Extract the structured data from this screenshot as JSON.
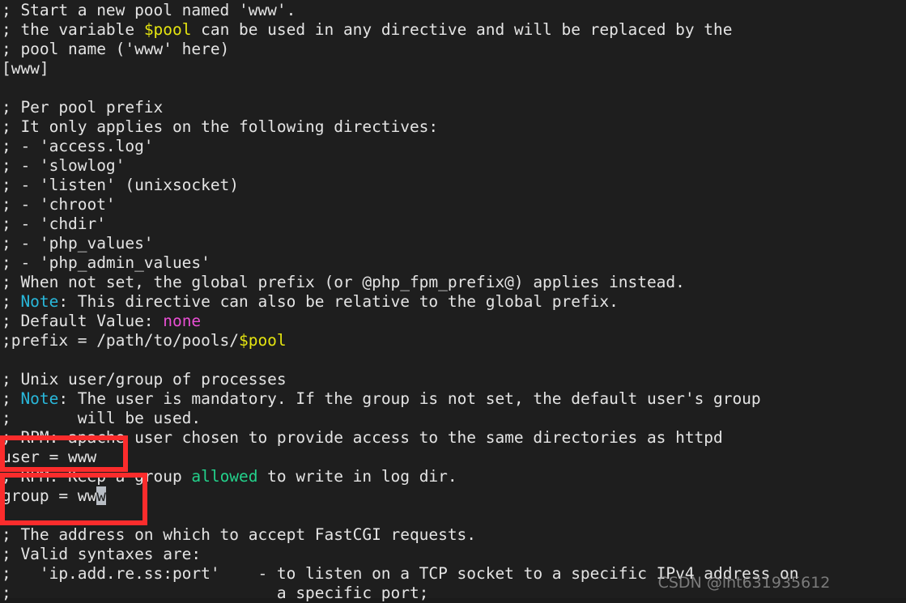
{
  "terminal": {
    "background_color": "#1e1e1e",
    "foreground_color": "#e4e4e4",
    "colors": {
      "variable_yellow": "#e5e510",
      "note_cyan": "#29b8db",
      "none_magenta": "#e94fd4",
      "allowed_green": "#23d18b",
      "cursor_gray": "#b8bdc4",
      "annotation_red": "#fb2c2c"
    },
    "file_content_lines": [
      "; Start a new pool named 'www'.",
      "; the variable $pool can be used in any directive and will be replaced by the",
      "; pool name ('www' here)",
      "[www]",
      "",
      "; Per pool prefix",
      "; It only applies on the following directives:",
      "; - 'access.log'",
      "; - 'slowlog'",
      "; - 'listen' (unixsocket)",
      "; - 'chroot'",
      "; - 'chdir'",
      "; - 'php_values'",
      "; - 'php_admin_values'",
      "; When not set, the global prefix (or @php_fpm_prefix@) applies instead.",
      "; Note: This directive can also be relative to the global prefix.",
      "; Default Value: none",
      ";prefix = /path/to/pools/$pool",
      "",
      "; Unix user/group of processes",
      "; Note: The user is mandatory. If the group is not set, the default user's group",
      ";       will be used.",
      "; RPM: apache user chosen to provide access to the same directories as httpd",
      "user = www",
      "; RPM: Keep a group allowed to write in log dir.",
      "group = www",
      "",
      "; The address on which to accept FastCGI requests.",
      "; Valid syntaxes are:",
      ";   'ip.add.re.ss:port'    - to listen on a TCP socket to a specific IPv4 address on",
      ";                            a specific port;"
    ],
    "lines": [
      {
        "id": "l1",
        "segments": [
          {
            "text": "; Start a new pool named 'www'.",
            "color": "plain"
          }
        ]
      },
      {
        "id": "l2",
        "segments": [
          {
            "text": "; the variable ",
            "color": "plain"
          },
          {
            "text": "$pool",
            "color": "var"
          },
          {
            "text": " can be used in any directive and will be replaced by the",
            "color": "plain"
          }
        ]
      },
      {
        "id": "l3",
        "segments": [
          {
            "text": "; pool name ('www' here)",
            "color": "plain"
          }
        ]
      },
      {
        "id": "l4",
        "segments": [
          {
            "text": "[www]",
            "color": "plain"
          }
        ]
      },
      {
        "id": "l5",
        "segments": [
          {
            "text": "",
            "color": "plain"
          }
        ]
      },
      {
        "id": "l6",
        "segments": [
          {
            "text": "; Per pool prefix",
            "color": "plain"
          }
        ]
      },
      {
        "id": "l7",
        "segments": [
          {
            "text": "; It only applies on the following directives:",
            "color": "plain"
          }
        ]
      },
      {
        "id": "l8",
        "segments": [
          {
            "text": "; - 'access.log'",
            "color": "plain"
          }
        ]
      },
      {
        "id": "l9",
        "segments": [
          {
            "text": "; - 'slowlog'",
            "color": "plain"
          }
        ]
      },
      {
        "id": "l10",
        "segments": [
          {
            "text": "; - 'listen' (unixsocket)",
            "color": "plain"
          }
        ]
      },
      {
        "id": "l11",
        "segments": [
          {
            "text": "; - 'chroot'",
            "color": "plain"
          }
        ]
      },
      {
        "id": "l12",
        "segments": [
          {
            "text": "; - 'chdir'",
            "color": "plain"
          }
        ]
      },
      {
        "id": "l13",
        "segments": [
          {
            "text": "; - 'php_values'",
            "color": "plain"
          }
        ]
      },
      {
        "id": "l14",
        "segments": [
          {
            "text": "; - 'php_admin_values'",
            "color": "plain"
          }
        ]
      },
      {
        "id": "l15",
        "segments": [
          {
            "text": "; When not set, the global prefix (or @php_fpm_prefix@) applies instead.",
            "color": "plain"
          }
        ]
      },
      {
        "id": "l16",
        "segments": [
          {
            "text": "; ",
            "color": "plain"
          },
          {
            "text": "Note",
            "color": "note"
          },
          {
            "text": ": This directive can also be relative to the global prefix.",
            "color": "plain"
          }
        ]
      },
      {
        "id": "l17",
        "segments": [
          {
            "text": "; Default Value: ",
            "color": "plain"
          },
          {
            "text": "none",
            "color": "none"
          }
        ]
      },
      {
        "id": "l18",
        "segments": [
          {
            "text": ";prefix = /path/to/pools/",
            "color": "plain"
          },
          {
            "text": "$pool",
            "color": "var"
          }
        ]
      },
      {
        "id": "l19",
        "segments": [
          {
            "text": "",
            "color": "plain"
          }
        ]
      },
      {
        "id": "l20",
        "segments": [
          {
            "text": "; Unix user/group of processes",
            "color": "plain"
          }
        ]
      },
      {
        "id": "l21",
        "segments": [
          {
            "text": "; ",
            "color": "plain"
          },
          {
            "text": "Note",
            "color": "note"
          },
          {
            "text": ": The user is mandatory. If the group is not set, the default user's group",
            "color": "plain"
          }
        ]
      },
      {
        "id": "l22",
        "segments": [
          {
            "text": ";       will be used.",
            "color": "plain"
          }
        ]
      },
      {
        "id": "l23",
        "segments": [
          {
            "text": "; RPM: apache user chosen to provide access to the same directories as httpd",
            "color": "plain"
          }
        ]
      },
      {
        "id": "l24",
        "segments": [
          {
            "text": "user = www",
            "color": "plain"
          }
        ]
      },
      {
        "id": "l25",
        "segments": [
          {
            "text": "; RPM: Keep a group ",
            "color": "plain"
          },
          {
            "text": "allowed",
            "color": "ok"
          },
          {
            "text": " to write in log dir.",
            "color": "plain"
          }
        ]
      },
      {
        "id": "l26",
        "segments": [
          {
            "text": "group = ww",
            "color": "plain"
          },
          {
            "text": "w",
            "color": "cursor"
          }
        ]
      },
      {
        "id": "l27",
        "segments": [
          {
            "text": "",
            "color": "plain"
          }
        ]
      },
      {
        "id": "l28",
        "segments": [
          {
            "text": "; The address on which to accept FastCGI requests.",
            "color": "plain"
          }
        ]
      },
      {
        "id": "l29",
        "segments": [
          {
            "text": "; Valid syntaxes are:",
            "color": "plain"
          }
        ]
      },
      {
        "id": "l30",
        "segments": [
          {
            "text": ";   'ip.add.re.ss:port'    - to listen on a TCP socket to a specific IPv4 address on",
            "color": "plain"
          }
        ]
      },
      {
        "id": "l31",
        "segments": [
          {
            "text": ";                            a specific port;",
            "color": "plain"
          }
        ]
      }
    ]
  },
  "annotations": [
    {
      "id": "annot-user",
      "label": "user-directive-highlight",
      "targets_line": "user = www"
    },
    {
      "id": "annot-group",
      "label": "group-directive-highlight",
      "targets_line": "group = www"
    }
  ],
  "cursor": {
    "line": "group = www",
    "column": 11,
    "character": "w"
  },
  "watermark": {
    "text": "CSDN @lht631935612"
  }
}
